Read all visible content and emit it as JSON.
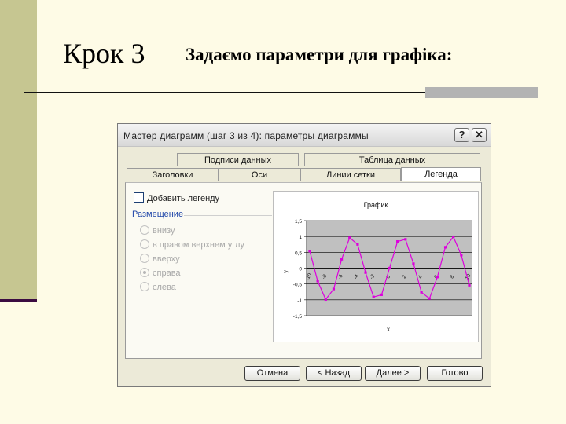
{
  "slide": {
    "title": "Крок 3",
    "subtitle": "Задаємо параметри для графіка:"
  },
  "dialog": {
    "title": "Мастер диаграмм (шаг 3 из 4): параметры диаграммы",
    "help_icon": "question-icon",
    "close_icon": "close-icon",
    "tabs_back": [
      "Подписи данных",
      "Таблица данных"
    ],
    "tabs_front": [
      "Заголовки",
      "Оси",
      "Линии сетки",
      "Легенда"
    ],
    "active_tab": "Легенда",
    "legend_checkbox": {
      "label": "Добавить легенду",
      "checked": false
    },
    "placement_label": "Размещение",
    "placement_options": [
      {
        "label": "внизу",
        "selected": false
      },
      {
        "label": "в правом верхнем углу",
        "selected": false
      },
      {
        "label": "вверху",
        "selected": false
      },
      {
        "label": "справа",
        "selected": true
      },
      {
        "label": "слева",
        "selected": false
      }
    ],
    "buttons": {
      "cancel": "Отмена",
      "back": "< Назад",
      "next": "Далее >",
      "finish": "Готово"
    }
  },
  "chart_data": {
    "type": "line",
    "title": "График",
    "xlabel": "x",
    "ylabel": "y",
    "ylim": [
      -1.5,
      1.5
    ],
    "y_ticks": [
      "1,5",
      "1",
      "0,5",
      "0",
      "-0,5",
      "-1",
      "-1,5"
    ],
    "x_ticks": [
      "-10",
      "-8",
      "-6",
      "-4",
      "-2",
      "0",
      "2",
      "4",
      "6",
      "8",
      "10"
    ],
    "grid": true,
    "legend": "none",
    "colors": {
      "line": "#dd00dd",
      "plot_area": "#c0c0c0"
    },
    "series": [
      {
        "x": [
          -10,
          -9,
          -8,
          -7,
          -6,
          -5,
          -4,
          -3,
          -2,
          -1,
          0,
          1,
          2,
          3,
          4,
          5,
          6,
          7,
          8,
          9,
          10
        ],
        "y": [
          0.54,
          -0.41,
          -0.99,
          -0.66,
          0.28,
          0.96,
          0.75,
          -0.14,
          -0.91,
          -0.84,
          0.0,
          0.84,
          0.91,
          0.14,
          -0.76,
          -0.96,
          -0.28,
          0.66,
          0.99,
          0.41,
          -0.54
        ]
      }
    ]
  }
}
